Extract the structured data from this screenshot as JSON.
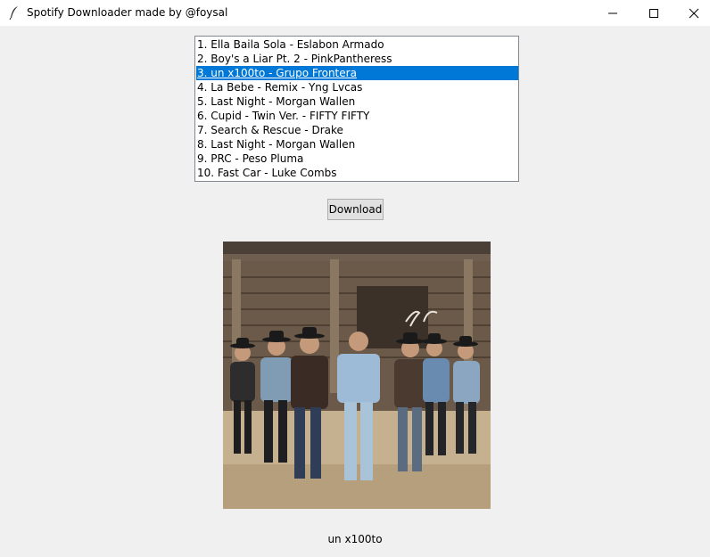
{
  "window": {
    "title": "Spotify Downloader made by @foysal",
    "icon": "feather-icon"
  },
  "songs": [
    "1. Ella Baila Sola - Eslabon Armado",
    "2. Boy's a Liar Pt. 2 - PinkPantheress",
    "3. un x100to - Grupo Frontera",
    "4. La Bebe - Remix - Yng Lvcas",
    "5. Last Night - Morgan Wallen",
    "6. Cupid - Twin Ver. - FIFTY FIFTY",
    "7. Search & Rescue - Drake",
    "8. Last Night - Morgan Wallen",
    "9. PRC - Peso Pluma",
    "10. Fast Car - Luke Combs"
  ],
  "selected_index": 2,
  "download_button": "Download",
  "now_selected": {
    "title": "un x100to"
  },
  "colors": {
    "selection": "#0078d7",
    "background": "#f0f0f0"
  }
}
